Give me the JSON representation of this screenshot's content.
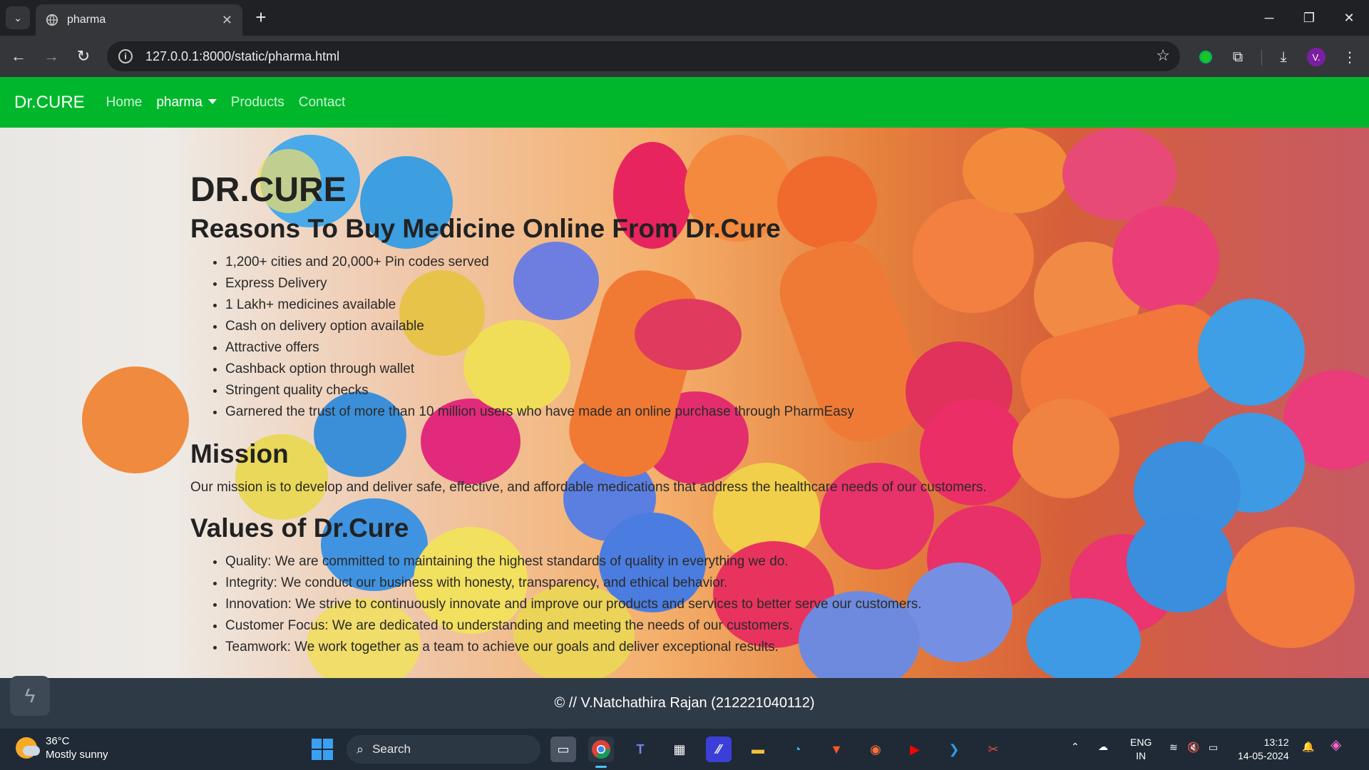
{
  "browser": {
    "tab_title": "pharma",
    "url": "127.0.0.1:8000/static/pharma.html",
    "profile_initial": "V."
  },
  "site": {
    "brand": "Dr.CURE",
    "nav": [
      {
        "label": "Home",
        "active": false
      },
      {
        "label": "pharma",
        "active": true,
        "dropdown": true
      },
      {
        "label": "Products",
        "active": false
      },
      {
        "label": "Contact",
        "active": false
      }
    ],
    "heading": "DR.CURE",
    "reasons_heading": "Reasons To Buy Medicine Online From Dr.Cure",
    "reasons": [
      "1,200+ cities and 20,000+ Pin codes served",
      "Express Delivery",
      "1 Lakh+ medicines available",
      "Cash on delivery option available",
      "Attractive offers",
      "Cashback option through wallet",
      "Stringent quality checks",
      "Garnered the trust of more than 10 million users who have made an online purchase through PharmEasy"
    ],
    "mission_heading": "Mission",
    "mission_text": "Our mission is to develop and deliver safe, effective, and affordable medications that address the healthcare needs of our customers.",
    "values_heading": "Values of Dr.Cure",
    "values": [
      "Quality: We are committed to maintaining the highest standards of quality in everything we do.",
      "Integrity: We conduct our business with honesty, transparency, and ethical behavior.",
      "Innovation: We strive to continuously innovate and improve our products and services to better serve our customers.",
      "Customer Focus: We are dedicated to understanding and meeting the needs of our customers.",
      "Teamwork: We work together as a team to achieve our goals and deliver exceptional results."
    ],
    "footer": "© // V.Natchathira Rajan (212221040112)"
  },
  "taskbar": {
    "weather_temp": "36°C",
    "weather_desc": "Mostly sunny",
    "search_label": "Search",
    "lang_line1": "ENG",
    "lang_line2": "IN",
    "time": "13:12",
    "date": "14-05-2024"
  },
  "colors": {
    "navbar": "#00b72c",
    "footer": "#2f3a47",
    "taskbar": "#1f2a36"
  }
}
